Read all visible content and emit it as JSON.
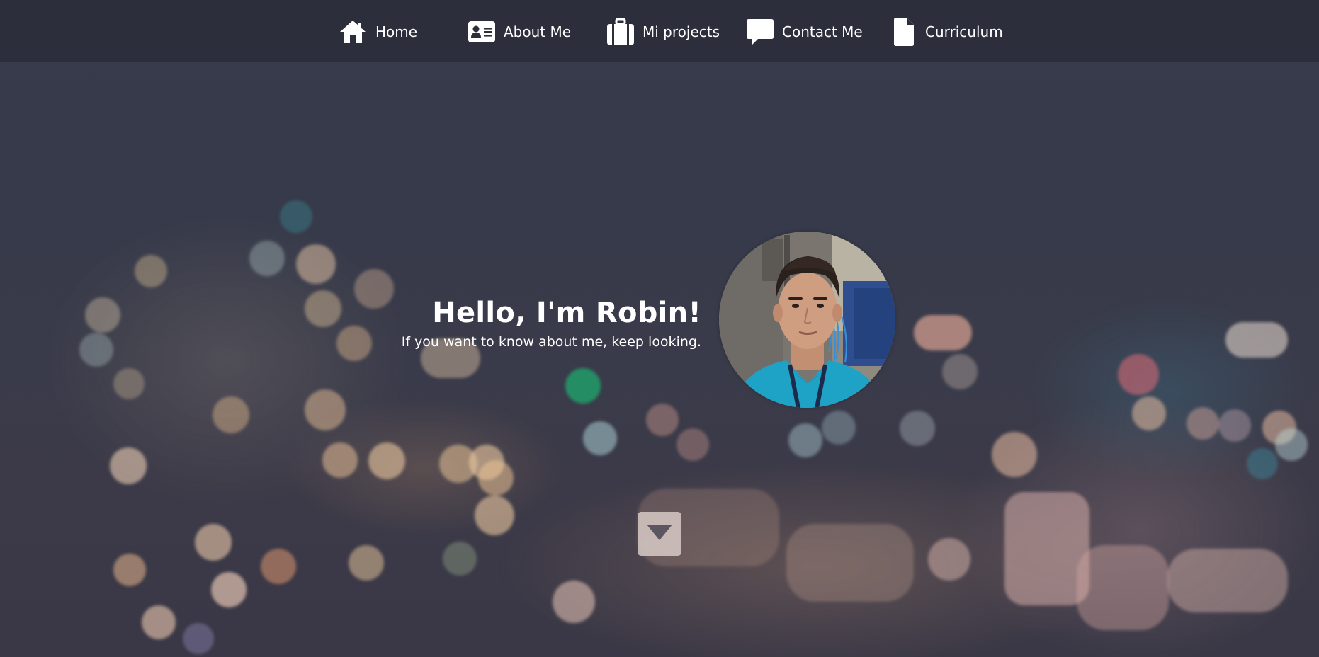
{
  "nav": {
    "items": [
      {
        "label": "Home",
        "icon": "home-icon"
      },
      {
        "label": "About Me",
        "icon": "id-card-icon"
      },
      {
        "label": "Mi projects",
        "icon": "suitcase-icon"
      },
      {
        "label": "Contact Me",
        "icon": "speech-bubble-icon"
      },
      {
        "label": "Curriculum",
        "icon": "file-icon"
      }
    ]
  },
  "hero": {
    "title": "Hello, I'm Robin!",
    "subtitle": "If you want to know about me, keep looking."
  },
  "avatar": {
    "icon": "profile-photo"
  },
  "scroll": {
    "icon": "caret-down-icon"
  },
  "colors": {
    "navbar": "#2c2e3a",
    "background": "#383b4b",
    "text": "#ffffff",
    "scroll_button": "#d6c8c4",
    "shirt": "#1ea3c6"
  }
}
